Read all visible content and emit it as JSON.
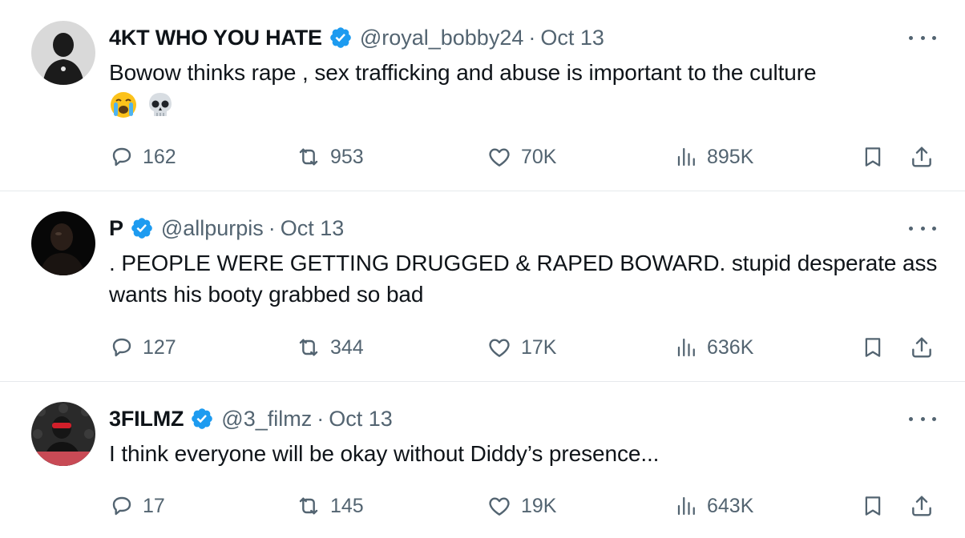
{
  "tweets": [
    {
      "name": "4KT WHO YOU HATE",
      "handle": "@royal_bobby24",
      "separator": "·",
      "date": "Oct 13",
      "text": "Bowow thinks rape , sex trafficking and abuse is important to the culture",
      "emojis": [
        "crying-face-emoji",
        "skull-emoji"
      ],
      "replies": "162",
      "reposts": "953",
      "likes": "70K",
      "views": "895K"
    },
    {
      "name": "P",
      "handle": "@allpurpis",
      "separator": "·",
      "date": "Oct 13",
      "text": ". PEOPLE WERE GETTING DRUGGED & RAPED BOWARD. stupid desperate ass wants his booty grabbed so bad",
      "replies": "127",
      "reposts": "344",
      "likes": "17K",
      "views": "636K"
    },
    {
      "name": "3FILMZ",
      "handle": "@3_filmz",
      "separator": "·",
      "date": "Oct 13",
      "text": "I think everyone will be okay without Diddy’s presence...",
      "replies": "17",
      "reposts": "145",
      "likes": "19K",
      "views": "643K"
    }
  ],
  "icons": {
    "verified": "verified-badge-icon",
    "reply": "reply-icon",
    "repost": "repost-icon",
    "like": "heart-icon",
    "views": "views-icon",
    "bookmark": "bookmark-icon",
    "share": "share-icon",
    "more": "more-icon"
  },
  "colors": {
    "verified_blue": "#1d9bf0",
    "secondary_text": "#536471",
    "primary_text": "#0f1419",
    "divider": "#e6e9ec"
  }
}
